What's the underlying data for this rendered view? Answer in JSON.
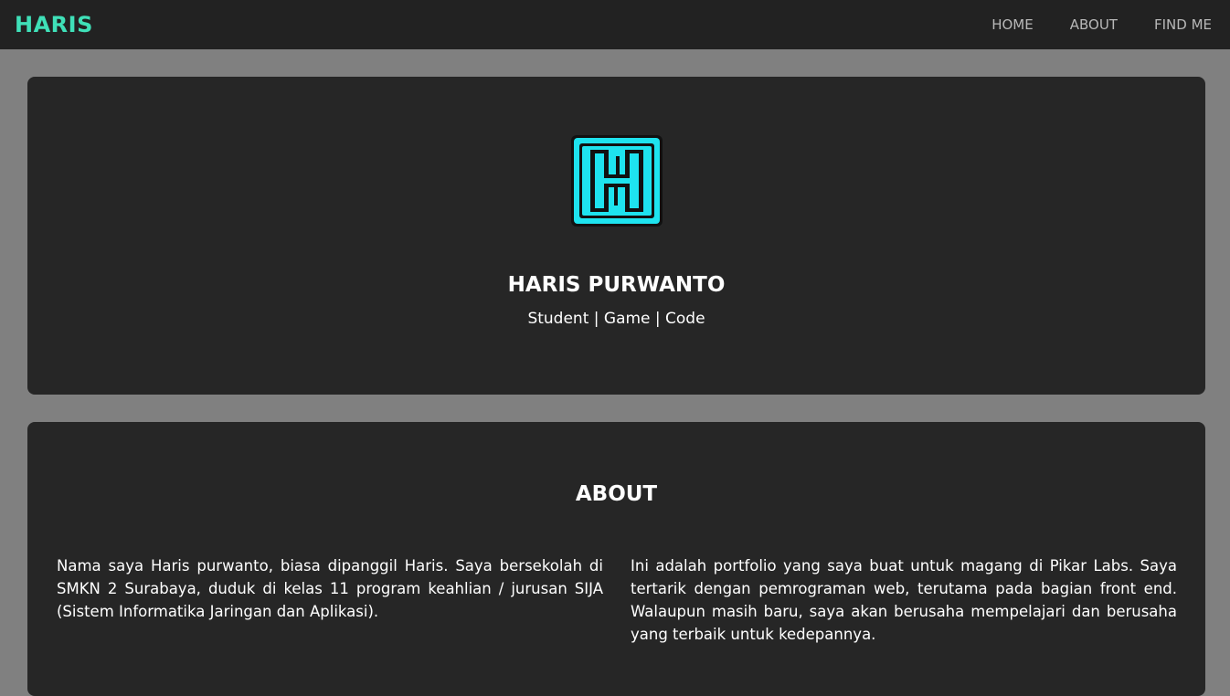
{
  "navbar": {
    "brand": "HARIS",
    "links": [
      {
        "label": "HOME"
      },
      {
        "label": "ABOUT"
      },
      {
        "label": "FIND ME"
      }
    ]
  },
  "hero": {
    "logo_icon": "h-monogram-logo-icon",
    "name": "HARIS PURWANTO",
    "tagline": "Student | Game | Code"
  },
  "about": {
    "title": "ABOUT",
    "paragraph_left": "Nama saya Haris purwanto, biasa dipanggil Haris. Saya bersekolah di SMKN 2 Surabaya, duduk di kelas 11 program keahlian / jurusan SIJA (Sistem Informatika Jaringan dan Aplikasi).",
    "paragraph_right": "Ini adalah portfolio yang saya buat untuk magang di Pikar Labs. Saya tertarik dengan pemrograman web, terutama pada bagian front end. Walaupun masih baru, saya akan berusaha mempelajari dan berusaha yang terbaik untuk kedepannya."
  },
  "colors": {
    "page_background": "#808080",
    "navbar_background": "#222222",
    "card_background": "#262626",
    "brand_accent": "#3fe0b8",
    "logo_cyan": "#1ee3ef"
  }
}
